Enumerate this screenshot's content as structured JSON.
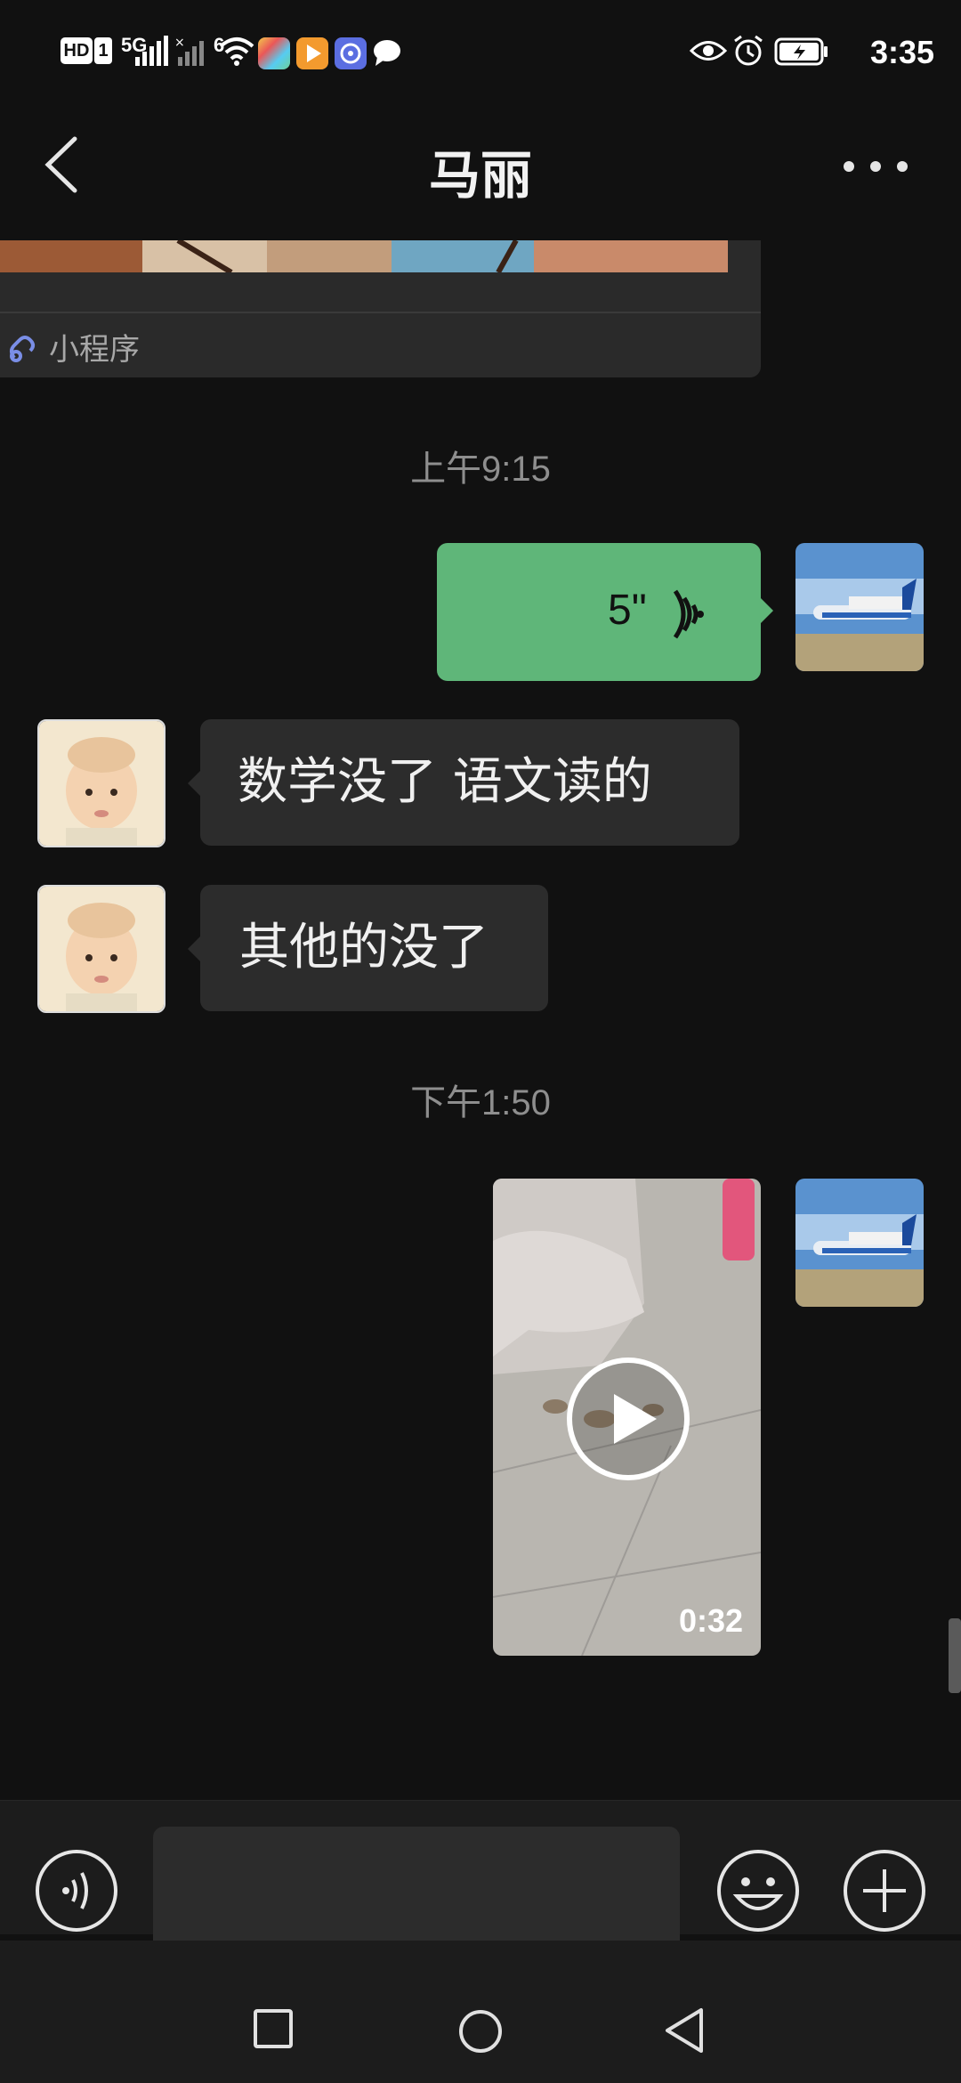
{
  "status_bar": {
    "network_hd": "HD",
    "sim": "1",
    "network_type": "5G",
    "wifi_sub": "6",
    "time": "3:35"
  },
  "header": {
    "title": "马丽"
  },
  "messages": {
    "mini_program_label": "小程序",
    "timestamp_1": "上午9:15",
    "voice_duration": "5\"",
    "in_msg_1": "数学没了  语文读的",
    "in_msg_2": "其他的没了",
    "timestamp_2": "下午1:50",
    "video_duration": "0:32"
  },
  "input": {
    "placeholder": ""
  },
  "colors": {
    "background": "#111111",
    "outgoing_bubble": "#5fb679",
    "incoming_bubble": "#2c2c2c"
  },
  "icons": {
    "back": "chevron-left-icon",
    "more": "more-dots-icon",
    "voice_toggle": "voice-icon",
    "emoji": "emoji-icon",
    "plus": "plus-icon",
    "play": "play-icon"
  }
}
